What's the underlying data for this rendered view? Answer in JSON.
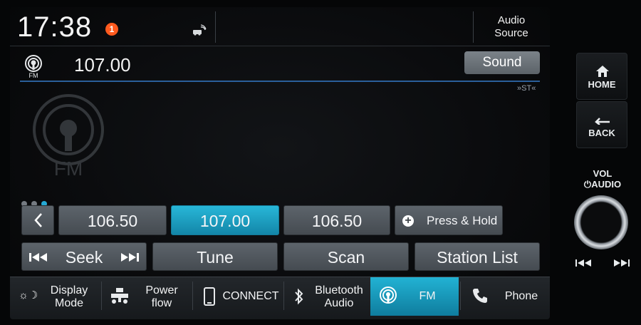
{
  "status": {
    "time": "17:38",
    "notification_count": "1",
    "audio_source_line1": "Audio",
    "audio_source_line2": "Source"
  },
  "station": {
    "band_icon_label": "FM",
    "frequency": "107.00",
    "sound_label": "Sound",
    "stereo_indicator": "ST",
    "watermark_label": "FM"
  },
  "pager": {
    "pages": 3,
    "current": 3
  },
  "presets": [
    {
      "label": "106.50",
      "active": false
    },
    {
      "label": "107.00",
      "active": true
    },
    {
      "label": "106.50",
      "active": false
    }
  ],
  "press_hold_label": "Press & Hold",
  "actions": {
    "seek": "Seek",
    "tune": "Tune",
    "scan": "Scan",
    "station_list": "Station List"
  },
  "nav": {
    "display_mode_1": "Display",
    "display_mode_2": "Mode",
    "power_flow_1": "Power",
    "power_flow_2": "flow",
    "connect": "CONNECT",
    "bluetooth_1": "Bluetooth",
    "bluetooth_2": "Audio",
    "fm": "FM",
    "phone": "Phone"
  },
  "hardware": {
    "home": "HOME",
    "back": "BACK",
    "vol_line1": "VOL",
    "vol_line2": "AUDIO"
  },
  "colors": {
    "accent": "#1ea3c9",
    "notification": "#ff5a1e",
    "divider": "#2a5f9a"
  }
}
